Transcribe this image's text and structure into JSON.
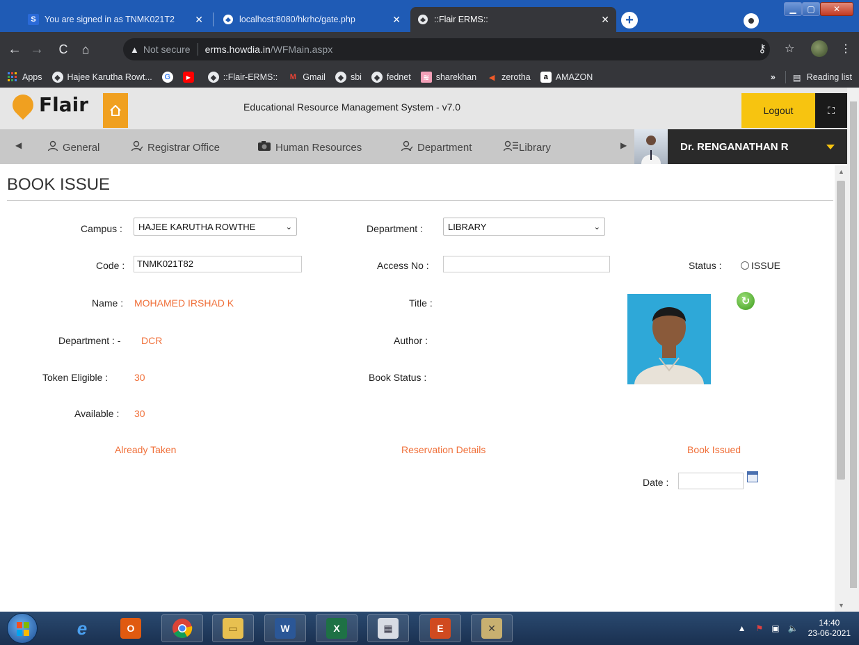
{
  "browser": {
    "tabs": [
      {
        "title": "You are signed in as TNMK021T2",
        "icon": "s-favicon-icon"
      },
      {
        "title": "localhost:8080/hkrhc/gate.php",
        "icon": "globe-icon"
      },
      {
        "title": "::Flair ERMS::",
        "icon": "globe-icon"
      }
    ],
    "url": {
      "security": "Not secure",
      "host": "erms.howdia.in",
      "path": "/WFMain.aspx"
    },
    "bookmarks": [
      {
        "label": "Apps",
        "icon": "apps-grid-icon"
      },
      {
        "label": "Hajee Karutha Rowt...",
        "icon": "globe-icon"
      },
      {
        "label": "",
        "icon": "google-icon"
      },
      {
        "label": "",
        "icon": "youtube-icon"
      },
      {
        "label": "::Flair-ERMS::",
        "icon": "globe-icon"
      },
      {
        "label": "Gmail",
        "icon": "gmail-icon"
      },
      {
        "label": "sbi",
        "icon": "globe-icon"
      },
      {
        "label": "fednet",
        "icon": "globe-icon"
      },
      {
        "label": "sharekhan",
        "icon": "sharekhan-icon"
      },
      {
        "label": "zerotha",
        "icon": "zerodha-icon"
      },
      {
        "label": "AMAZON",
        "icon": "amazon-icon"
      }
    ],
    "reading_list": "Reading list",
    "overflow": "»"
  },
  "app": {
    "logo_text": "Flair",
    "system_title": "Educational Resource Management System - v7.0",
    "logout": "Logout",
    "menu": [
      {
        "label": "General",
        "icon": "user-icon"
      },
      {
        "label": "Registrar Office",
        "icon": "user-check-icon"
      },
      {
        "label": "Human Resources",
        "icon": "camera-icon"
      },
      {
        "label": "Department",
        "icon": "user-check-icon"
      },
      {
        "label": "Library",
        "icon": "user-list-icon"
      }
    ],
    "user_name": "Dr. RENGANATHAN R"
  },
  "page": {
    "title": "BOOK ISSUE",
    "campus_label": "Campus :",
    "campus_value": "HAJEE KARUTHA ROWTHE",
    "department_label": "Department :",
    "department_value": "LIBRARY",
    "code_label": "Code :",
    "code_value": "TNMK021T82",
    "access_label": "Access No :",
    "access_value": "",
    "status_label": "Status :",
    "status_option": "ISSUE",
    "name_label": "Name :",
    "name_value": "MOHAMED IRSHAD K",
    "title_label": "Title :",
    "dept2_label": "Department : -",
    "dept2_value": "DCR",
    "author_label": "Author :",
    "token_label": "Token Eligible :",
    "token_value": "30",
    "book_status_label": "Book Status :",
    "available_label": "Available :",
    "available_value": "30",
    "already_taken": "Already Taken",
    "reservation_details": "Reservation Details",
    "book_issued": "Book Issued",
    "date_label": "Date :",
    "date_value": ""
  },
  "taskbar": {
    "time": "14:40",
    "date": "23-06-2021"
  },
  "colors": {
    "accent_orange": "#f0703a",
    "logo_orange": "#f0a020",
    "logout_yellow": "#f7c410",
    "user_panel": "#2a2a2a"
  }
}
